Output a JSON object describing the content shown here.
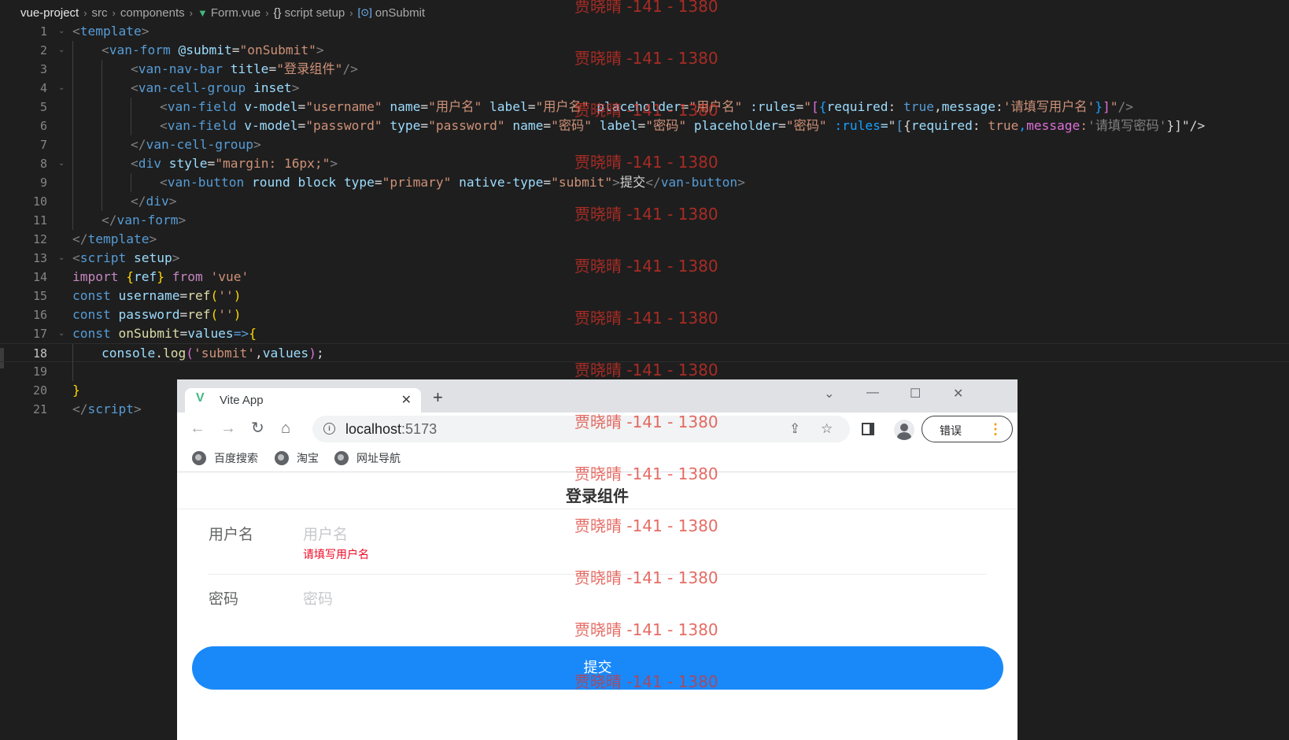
{
  "breadcrumb": {
    "project": "vue-project",
    "src": "src",
    "components": "components",
    "file": "Form.vue",
    "section": "script setup",
    "symbol": "onSubmit"
  },
  "code": {
    "l1": [
      "<",
      "template",
      ">"
    ],
    "l2": [
      "<",
      "van-form",
      " ",
      "@submit",
      "=",
      "\"onSubmit\"",
      ">"
    ],
    "l3": [
      "<",
      "van-nav-bar",
      " ",
      "title",
      "=",
      "\"登录组件\"",
      "/>"
    ],
    "l4": [
      "<",
      "van-cell-group",
      " ",
      "inset",
      ">"
    ],
    "l5": [
      "<",
      "van-field",
      " ",
      "v-model",
      "=",
      "\"username\"",
      " ",
      "name",
      "=",
      "\"用户名\"",
      " ",
      "label",
      "=",
      "\"用户名\"",
      " ",
      "placeholder",
      "=",
      "\"用户名\"",
      " ",
      ":rules",
      "=",
      "\"",
      "[",
      "{",
      "required",
      ": ",
      "true",
      ",",
      "message",
      ":",
      "'请填写用户名'",
      "}",
      "]",
      "\"",
      "/>"
    ],
    "l6": [
      "<",
      "van-field",
      " ",
      "v-model",
      "=",
      "\"password\"",
      " ",
      "type",
      "=",
      "\"password\"",
      " ",
      "name",
      "=",
      "\"密码\"",
      " ",
      "label",
      "=",
      "\"密码\"",
      " ",
      "placeholder",
      "=",
      "\"密码\"",
      " ",
      ":rules",
      "=",
      "\"",
      "[",
      "{",
      "required",
      ": ",
      "true",
      ",",
      "message",
      ":",
      "'请填写密码'",
      "}",
      "]",
      "\"",
      "/>"
    ],
    "l7": [
      "</",
      "van-cell-group",
      ">"
    ],
    "l8": [
      "<",
      "div",
      " ",
      "style",
      "=",
      "\"margin: 16px;\"",
      ">"
    ],
    "l9": [
      "<",
      "van-button",
      " ",
      "round",
      " ",
      "block",
      " ",
      "type",
      "=",
      "\"primary\"",
      " ",
      "native-type",
      "=",
      "\"submit\"",
      ">",
      "提交",
      "</",
      "van-button",
      ">"
    ],
    "l10": [
      "</",
      "div",
      ">"
    ],
    "l11": [
      "</",
      "van-form",
      ">"
    ],
    "l12": [
      "</",
      "template",
      ">"
    ],
    "l13": [
      "<",
      "script",
      " ",
      "setup",
      ">"
    ],
    "l14": [
      "import",
      " ",
      "{",
      "ref",
      "}",
      " ",
      "from",
      " ",
      "'vue'"
    ],
    "l15": [
      "const",
      " ",
      "username",
      "=",
      "ref",
      "(",
      "''",
      ")"
    ],
    "l16": [
      "const",
      " ",
      "password",
      "=",
      "ref",
      "(",
      "''",
      ")"
    ],
    "l17": [
      "const",
      " ",
      "onSubmit",
      "=",
      "values",
      "=>",
      "{"
    ],
    "l18": [
      "console",
      ".",
      "log",
      "(",
      "'submit'",
      ",",
      "values",
      ")",
      ";"
    ],
    "l19": [],
    "l20": [
      "}"
    ],
    "l21": [
      "</",
      "script",
      ">"
    ]
  },
  "browser": {
    "tab_title": "Vite App",
    "close_glyph": "✕",
    "new_tab_glyph": "+",
    "url_host": "localhost",
    "url_port": ":5173",
    "error_label": "错误",
    "bookmarks": [
      "百度搜索",
      "淘宝",
      "网址导航"
    ]
  },
  "form": {
    "nav_title": "登录组件",
    "username_label": "用户名",
    "username_placeholder": "用户名",
    "username_error": "请填写用户名",
    "password_label": "密码",
    "password_placeholder": "密码",
    "submit_label": "提交"
  },
  "watermark": "贾晓晴 -141 - 1380",
  "colors": {
    "editor_bg": "#1e1e1e",
    "vant_primary": "#1989fa",
    "error_red": "#ee0a24",
    "watermark_red": "#dc3228"
  }
}
